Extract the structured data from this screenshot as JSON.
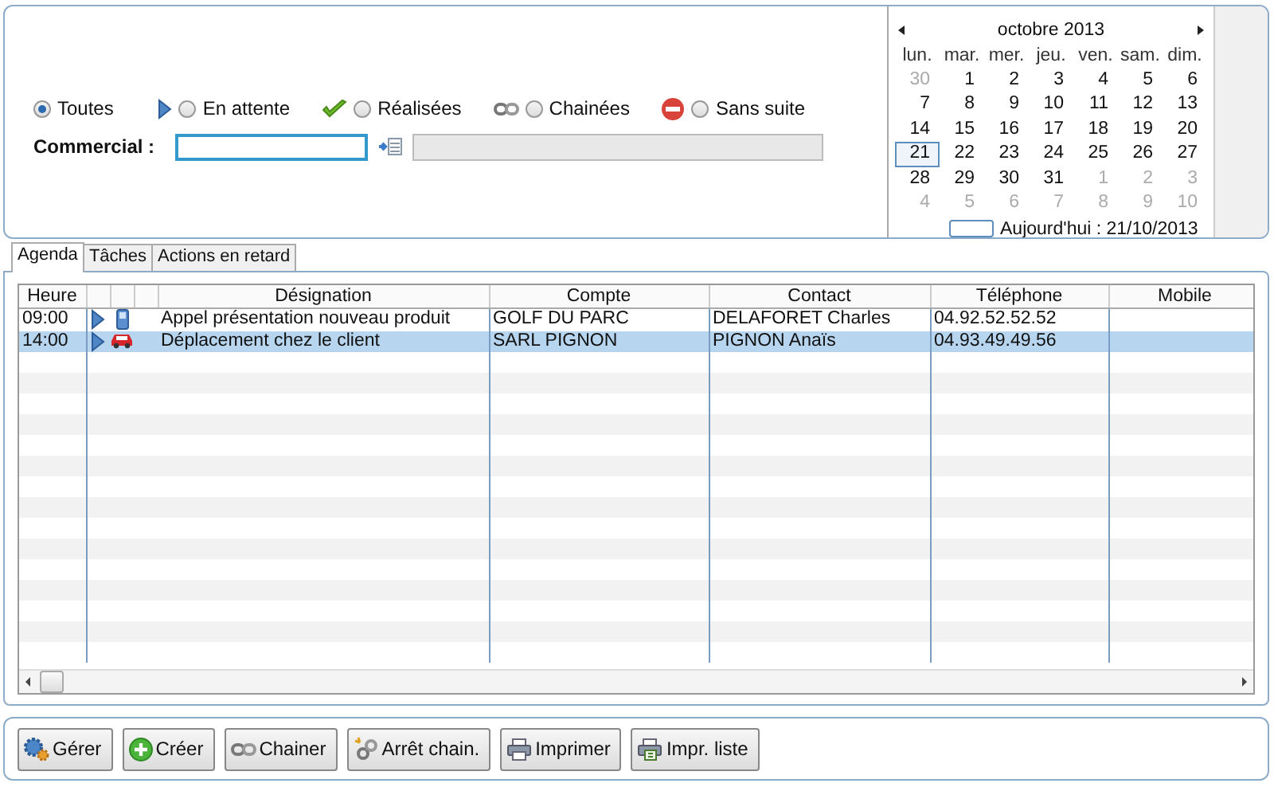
{
  "filters": [
    {
      "label": "Toutes",
      "kind": "all",
      "selected": true
    },
    {
      "label": "En attente",
      "kind": "pending",
      "selected": false
    },
    {
      "label": "Réalisées",
      "kind": "done",
      "selected": false
    },
    {
      "label": "Chainées",
      "kind": "chain",
      "selected": false
    },
    {
      "label": "Sans suite",
      "kind": "stop",
      "selected": false
    }
  ],
  "commercial": {
    "label": "Commercial :"
  },
  "calendar": {
    "title": "octobre 2013",
    "weekdays": [
      "lun.",
      "mar.",
      "mer.",
      "jeu.",
      "ven.",
      "sam.",
      "dim."
    ],
    "weeks": [
      [
        {
          "day": "30",
          "other_month": true,
          "selected": false
        },
        {
          "day": "1",
          "other_month": false,
          "selected": false
        },
        {
          "day": "2",
          "other_month": false,
          "selected": false
        },
        {
          "day": "3",
          "other_month": false,
          "selected": false
        },
        {
          "day": "4",
          "other_month": false,
          "selected": false
        },
        {
          "day": "5",
          "other_month": false,
          "selected": false
        },
        {
          "day": "6",
          "other_month": false,
          "selected": false
        }
      ],
      [
        {
          "day": "7",
          "other_month": false,
          "selected": false
        },
        {
          "day": "8",
          "other_month": false,
          "selected": false
        },
        {
          "day": "9",
          "other_month": false,
          "selected": false
        },
        {
          "day": "10",
          "other_month": false,
          "selected": false
        },
        {
          "day": "11",
          "other_month": false,
          "selected": false
        },
        {
          "day": "12",
          "other_month": false,
          "selected": false
        },
        {
          "day": "13",
          "other_month": false,
          "selected": false
        }
      ],
      [
        {
          "day": "14",
          "other_month": false,
          "selected": false
        },
        {
          "day": "15",
          "other_month": false,
          "selected": false
        },
        {
          "day": "16",
          "other_month": false,
          "selected": false
        },
        {
          "day": "17",
          "other_month": false,
          "selected": false
        },
        {
          "day": "18",
          "other_month": false,
          "selected": false
        },
        {
          "day": "19",
          "other_month": false,
          "selected": false
        },
        {
          "day": "20",
          "other_month": false,
          "selected": false
        }
      ],
      [
        {
          "day": "21",
          "other_month": false,
          "selected": true
        },
        {
          "day": "22",
          "other_month": false,
          "selected": false
        },
        {
          "day": "23",
          "other_month": false,
          "selected": false
        },
        {
          "day": "24",
          "other_month": false,
          "selected": false
        },
        {
          "day": "25",
          "other_month": false,
          "selected": false
        },
        {
          "day": "26",
          "other_month": false,
          "selected": false
        },
        {
          "day": "27",
          "other_month": false,
          "selected": false
        }
      ],
      [
        {
          "day": "28",
          "other_month": false,
          "selected": false
        },
        {
          "day": "29",
          "other_month": false,
          "selected": false
        },
        {
          "day": "30",
          "other_month": false,
          "selected": false
        },
        {
          "day": "31",
          "other_month": false,
          "selected": false
        },
        {
          "day": "1",
          "other_month": true,
          "selected": false
        },
        {
          "day": "2",
          "other_month": true,
          "selected": false
        },
        {
          "day": "3",
          "other_month": true,
          "selected": false
        }
      ],
      [
        {
          "day": "4",
          "other_month": true,
          "selected": false
        },
        {
          "day": "5",
          "other_month": true,
          "selected": false
        },
        {
          "day": "6",
          "other_month": true,
          "selected": false
        },
        {
          "day": "7",
          "other_month": true,
          "selected": false
        },
        {
          "day": "8",
          "other_month": true,
          "selected": false
        },
        {
          "day": "9",
          "other_month": true,
          "selected": false
        },
        {
          "day": "10",
          "other_month": true,
          "selected": false
        }
      ]
    ],
    "today": "Aujourd'hui : 21/10/2013"
  },
  "tabs": [
    {
      "label": "Agenda",
      "selected": true
    },
    {
      "label": "Tâches",
      "selected": false
    },
    {
      "label": "Actions en retard",
      "selected": false
    }
  ],
  "table": {
    "columns": [
      "Heure",
      "Désignation",
      "Compte",
      "Contact",
      "Téléphone",
      "Mobile"
    ],
    "rows": [
      {
        "heure": "09:00",
        "pending": true,
        "kind": "phone",
        "designation": "Appel présentation nouveau produit",
        "compte": "GOLF DU PARC",
        "contact": "DELAFORET Charles",
        "telephone": "04.92.52.52.52",
        "selected": false
      },
      {
        "heure": "14:00",
        "pending": true,
        "kind": "car",
        "designation": "Déplacement chez le client",
        "compte": "SARL PIGNON",
        "contact": "PIGNON Anaïs",
        "telephone": "04.93.49.49.56",
        "selected": true
      }
    ]
  },
  "buttons": [
    {
      "label": "Gérer",
      "kind": "gears"
    },
    {
      "label": "Créer",
      "kind": "plus"
    },
    {
      "label": "Chainer",
      "kind": "chain"
    },
    {
      "label": "Arrêt chain.",
      "kind": "chain-stop"
    },
    {
      "label": "Imprimer",
      "kind": "printer"
    },
    {
      "label": "Impr. liste",
      "kind": "printer-list"
    }
  ]
}
